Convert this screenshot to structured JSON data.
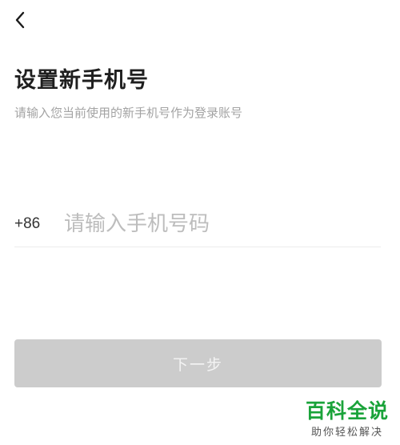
{
  "header": {
    "back_icon": "chevron-left-icon"
  },
  "page": {
    "title": "设置新手机号",
    "subtitle": "请输入您当前使用的新手机号作为登录账号"
  },
  "phone_field": {
    "country_code": "+86",
    "value": "",
    "placeholder": "请输入手机号码"
  },
  "next_button": {
    "label": "下一步"
  },
  "watermark": {
    "title": "百科全说",
    "subtitle": "助你轻松解决"
  },
  "colors": {
    "button_disabled": "#cccccc",
    "subtitle_text": "#a3a3a3",
    "placeholder_text": "#bdbdbd",
    "watermark_green": "#1aa33a"
  }
}
